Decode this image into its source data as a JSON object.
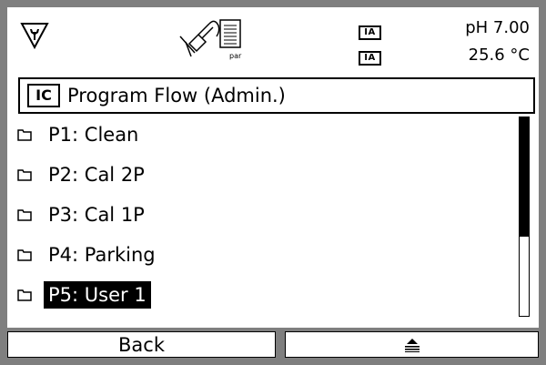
{
  "header": {
    "ia_top": "IA",
    "ia_bottom": "IA",
    "ph_value": "pH 7.00",
    "temperature": "25.6 °C",
    "sensor_icon_text": "par"
  },
  "title_bar": {
    "badge": "IC",
    "title": "Program Flow (Admin.)"
  },
  "list": {
    "items": [
      {
        "label": "P1: Clean",
        "selected": false
      },
      {
        "label": "P2: Cal 2P",
        "selected": false
      },
      {
        "label": "P3: Cal 1P",
        "selected": false
      },
      {
        "label": "P4: Parking",
        "selected": false
      },
      {
        "label": "P5: User 1",
        "selected": true
      }
    ],
    "scroll_fraction_visible": 0.6
  },
  "softkeys": {
    "left_label": "Back",
    "right_icon": "menu-lines-icon"
  },
  "colors": {
    "bezel": "#7f7f7f",
    "screen": "#ffffff",
    "ink": "#000000"
  }
}
